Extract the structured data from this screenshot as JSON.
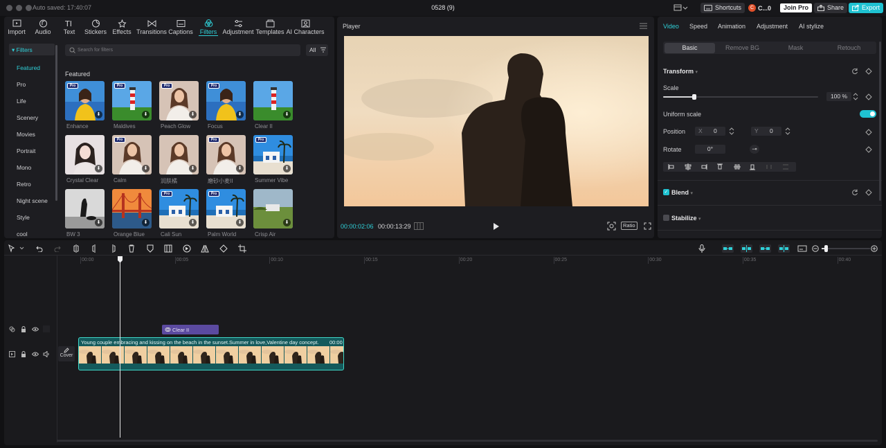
{
  "titlebar": {
    "autosave": "Auto saved: 17:40:07",
    "project_title": "0528 (9)",
    "shortcuts": "Shortcuts",
    "user": "C...0",
    "join_pro": "Join Pro",
    "share": "Share",
    "export": "Export"
  },
  "toolbar": {
    "items": [
      {
        "label": "Import",
        "icon": "import-icon"
      },
      {
        "label": "Audio",
        "icon": "audio-icon"
      },
      {
        "label": "Text",
        "icon": "text-icon"
      },
      {
        "label": "Stickers",
        "icon": "sticker-icon"
      },
      {
        "label": "Effects",
        "icon": "effects-icon"
      },
      {
        "label": "Transitions",
        "icon": "transitions-icon"
      },
      {
        "label": "Captions",
        "icon": "captions-icon"
      },
      {
        "label": "Filters",
        "icon": "filters-icon"
      },
      {
        "label": "Adjustment",
        "icon": "adjustment-icon"
      },
      {
        "label": "Templates",
        "icon": "templates-icon"
      },
      {
        "label": "AI Characters",
        "icon": "ai-characters-icon"
      }
    ],
    "active": "Filters"
  },
  "filters": {
    "header": "Filters",
    "categories": [
      "Featured",
      "Pro",
      "Life",
      "Scenery",
      "Movies",
      "Portrait",
      "Mono",
      "Retro",
      "Night scene",
      "Style",
      "cool"
    ],
    "search_placeholder": "Search for filters",
    "all_label": "All",
    "section_title": "Featured",
    "items": [
      {
        "name": "Enhance",
        "pro": true,
        "scene": "portrait-yellow"
      },
      {
        "name": "Maldives",
        "pro": true,
        "scene": "lighthouse"
      },
      {
        "name": "Peach Glow",
        "pro": true,
        "scene": "portrait-white"
      },
      {
        "name": "Focus",
        "pro": true,
        "scene": "portrait-yellow"
      },
      {
        "name": "Clear II",
        "pro": false,
        "scene": "lighthouse"
      },
      {
        "name": "Crystal Clear",
        "pro": false,
        "scene": "portrait-bw-soft"
      },
      {
        "name": "Calm",
        "pro": true,
        "scene": "portrait-white"
      },
      {
        "name": "润肤橘",
        "pro": false,
        "scene": "portrait-white"
      },
      {
        "name": "磨砂小麦II",
        "pro": true,
        "scene": "portrait-white"
      },
      {
        "name": "Summer Vibe",
        "pro": true,
        "scene": "house-sea"
      },
      {
        "name": "BW 3",
        "pro": false,
        "scene": "bw-dog"
      },
      {
        "name": "Orange Blue",
        "pro": false,
        "scene": "bridge"
      },
      {
        "name": "Cali Sun",
        "pro": true,
        "scene": "house-sea"
      },
      {
        "name": "Palm World",
        "pro": true,
        "scene": "house-sea"
      },
      {
        "name": "Crisp Air",
        "pro": false,
        "scene": "house-field"
      }
    ]
  },
  "player": {
    "title": "Player",
    "current_time": "00:00:02:06",
    "total_time": "00:00:13:29",
    "ratio_label": "Ratio"
  },
  "inspector": {
    "tabs": [
      "Video",
      "Speed",
      "Animation",
      "Adjustment",
      "AI stylize"
    ],
    "active_tab": "Video",
    "subtabs": [
      "Basic",
      "Remove BG",
      "Mask",
      "Retouch"
    ],
    "active_subtab": "Basic",
    "transform_label": "Transform",
    "scale_label": "Scale",
    "scale_value": "100",
    "scale_unit": "%",
    "scale_fraction": 0.2,
    "uniform_scale_label": "Uniform scale",
    "uniform_scale_on": true,
    "position_label": "Position",
    "pos_x_label": "X",
    "pos_x": "0",
    "pos_y_label": "Y",
    "pos_y": "0",
    "rotate_label": "Rotate",
    "rotate_value": "0°",
    "blend_label": "Blend",
    "blend_checked": true,
    "stabilize_label": "Stabilize",
    "stabilize_checked": false
  },
  "timeline": {
    "ticks": [
      "00:00",
      "00:05",
      "00:10",
      "00:15",
      "00:20",
      "00:25",
      "00:30",
      "00:35",
      "00:40"
    ],
    "filter_clip_label": "Clear II",
    "video_clip_label": "Young couple embracing and kissing on the beach in the sunset.Summer in love,Valentine day concept.",
    "video_clip_duration": "00:00",
    "cover_label": "Cover"
  },
  "colors": {
    "accent": "#2fd0d8",
    "pro_badge": "#1e2a6e",
    "filter_clip": "#5b4aa0",
    "video_clip_border": "#3fd6c7"
  }
}
